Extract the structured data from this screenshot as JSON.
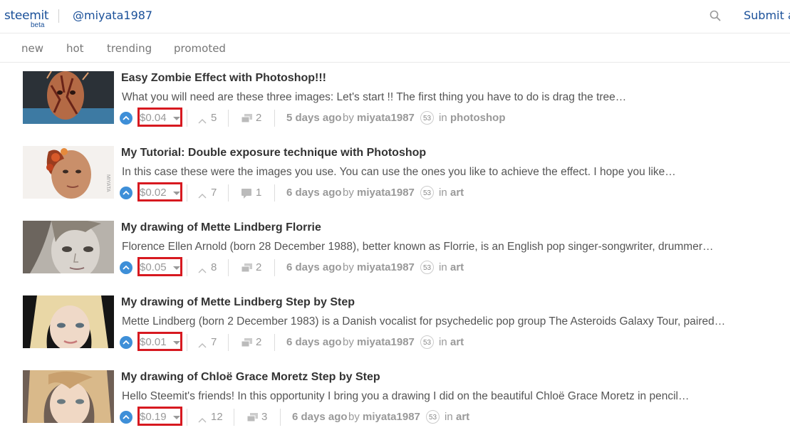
{
  "header": {
    "logo": "steemit",
    "logo_beta": "beta",
    "account": "@miyata1987",
    "submit_label": "Submit a"
  },
  "tabs": [
    {
      "label": "new"
    },
    {
      "label": "hot"
    },
    {
      "label": "trending"
    },
    {
      "label": "promoted"
    }
  ],
  "posts": [
    {
      "title": "Easy Zombie Effect with Photoshop!!!",
      "excerpt": "What you will need are these three images: Let's start !! The first thing you have to do is drag the tree…",
      "payout": "$0.04",
      "votes": "5",
      "comments": "2",
      "time": "5 days ago",
      "by": "by",
      "author": "miyata1987",
      "reputation": "53",
      "in": "in",
      "category": "photoshop"
    },
    {
      "title": "My Tutorial: Double exposure technique with Photoshop",
      "excerpt": "In this case these were the images you use. You can use the ones you like to achieve the effect. I hope you like…",
      "payout": "$0.02",
      "votes": "7",
      "comments": "1",
      "time": "6 days ago",
      "by": "by",
      "author": "miyata1987",
      "reputation": "53",
      "in": "in",
      "category": "art"
    },
    {
      "title": "My drawing of Mette Lindberg Florrie",
      "excerpt": "Florence Ellen Arnold (born 28 December 1988), better known as Florrie, is an English pop singer-songwriter, drummer…",
      "payout": "$0.05",
      "votes": "8",
      "comments": "2",
      "time": "6 days ago",
      "by": "by",
      "author": "miyata1987",
      "reputation": "53",
      "in": "in",
      "category": "art"
    },
    {
      "title": "My drawing of Mette Lindberg Step by Step",
      "excerpt": "Mette Lindberg (born 2 December 1983) is a Danish vocalist for psychedelic pop group The Asteroids Galaxy Tour, paired…",
      "payout": "$0.01",
      "votes": "7",
      "comments": "2",
      "time": "6 days ago",
      "by": "by",
      "author": "miyata1987",
      "reputation": "53",
      "in": "in",
      "category": "art"
    },
    {
      "title": "My drawing of Chloë Grace Moretz Step by Step",
      "excerpt": "Hello Steemit's friends! In this opportunity I bring you a drawing I did on the beautiful Chloë Grace Moretz in pencil…",
      "payout": "$0.19",
      "votes": "12",
      "comments": "3",
      "time": "6 days ago",
      "by": "by",
      "author": "miyata1987",
      "reputation": "53",
      "in": "in",
      "category": "art"
    }
  ],
  "colors": {
    "brand": "#1a5099",
    "upvote": "#3e8fd8",
    "highlight_box": "#d71920",
    "muted": "#999999"
  },
  "icons": {
    "search": "search-icon",
    "upvote": "upvote-icon",
    "votes": "votes-chevron-icon",
    "comments": "comment-icon",
    "payout_dropdown": "caret-down-icon"
  }
}
